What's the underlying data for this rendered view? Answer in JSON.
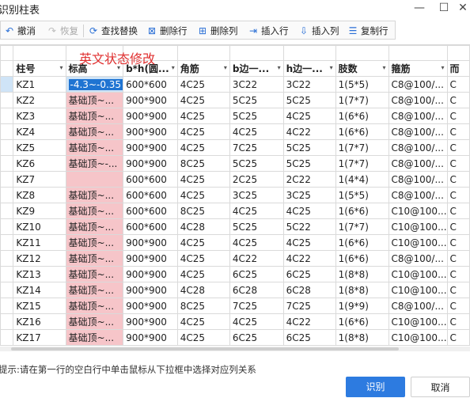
{
  "window": {
    "title": "识别柱表",
    "minimize_glyph": "—",
    "maximize_glyph": "☐",
    "close_glyph": "✕"
  },
  "toolbar": {
    "undo": {
      "label": "撤消",
      "icon": "undo-icon"
    },
    "redo": {
      "label": "恢复",
      "icon": "redo-icon"
    },
    "find_replace": {
      "label": "查找替换",
      "icon": "find-replace-icon"
    },
    "delete_row": {
      "label": "删除行",
      "icon": "delete-row-icon"
    },
    "delete_col": {
      "label": "删除列",
      "icon": "delete-column-icon"
    },
    "insert_row": {
      "label": "插入行",
      "icon": "insert-row-icon"
    },
    "insert_col": {
      "label": "插入列",
      "icon": "insert-column-icon"
    },
    "copy_row": {
      "label": "复制行",
      "icon": "copy-row-icon"
    }
  },
  "overlay_text": "英文状态修改",
  "grid": {
    "headers": [
      "柱号",
      "标高",
      "b*h(圆...",
      "角筋",
      "b边一...",
      "h边一...",
      "肢数",
      "箍筋",
      "而"
    ],
    "editing_value": "-4.3~-0.35",
    "rows": [
      [
        "KZ1",
        "-4.3~-0.35",
        "600*600",
        "4C25",
        "3C22",
        "3C22",
        "1(5*5)",
        "C8@100/..."
      ],
      [
        "KZ2",
        "基础顶~...",
        "900*900",
        "4C25",
        "5C25",
        "5C25",
        "1(7*7)",
        "C8@100/..."
      ],
      [
        "KZ3",
        "基础顶~...",
        "900*900",
        "4C25",
        "5C25",
        "4C25",
        "1(6*6)",
        "C8@100/..."
      ],
      [
        "KZ4",
        "基础顶~...",
        "900*900",
        "4C25",
        "4C25",
        "4C22",
        "1(6*6)",
        "C8@100/..."
      ],
      [
        "KZ5",
        "基础顶~...",
        "900*900",
        "4C25",
        "7C25",
        "5C25",
        "1(7*7)",
        "C8@100/..."
      ],
      [
        "KZ6",
        "基础顶~-...",
        "900*900",
        "8C25",
        "5C25",
        "5C25",
        "1(7*7)",
        "C8@100/..."
      ],
      [
        "KZ7",
        "",
        "600*600",
        "4C25",
        "2C25",
        "2C22",
        "1(4*4)",
        "C8@100/..."
      ],
      [
        "KZ8",
        "基础顶~...",
        "600*600",
        "4C25",
        "3C25",
        "3C25",
        "1(5*5)",
        "C8@100/..."
      ],
      [
        "KZ9",
        "基础顶~...",
        "600*600",
        "8C25",
        "4C25",
        "4C25",
        "1(6*6)",
        "C10@100..."
      ],
      [
        "KZ10",
        "基础顶~...",
        "600*600",
        "4C28",
        "5C25",
        "5C22",
        "1(7*7)",
        "C10@100..."
      ],
      [
        "KZ11",
        "基础顶~...",
        "900*900",
        "4C25",
        "4C25",
        "4C25",
        "1(6*6)",
        "C10@100..."
      ],
      [
        "KZ12",
        "基础顶~...",
        "900*900",
        "4C25",
        "4C22",
        "4C22",
        "1(6*6)",
        "C8@100/..."
      ],
      [
        "KZ13",
        "基础顶~...",
        "900*900",
        "4C25",
        "6C25",
        "6C25",
        "1(8*8)",
        "C10@100..."
      ],
      [
        "KZ14",
        "基础顶~...",
        "900*900",
        "4C28",
        "6C28",
        "6C28",
        "1(8*8)",
        "C10@100..."
      ],
      [
        "KZ15",
        "基础顶~...",
        "900*900",
        "8C25",
        "7C25",
        "7C25",
        "1(9*9)",
        "C8@100/..."
      ],
      [
        "KZ16",
        "基础顶~...",
        "900*900",
        "4C25",
        "4C25",
        "4C22",
        "1(6*6)",
        "C10@100..."
      ],
      [
        "KZ17",
        "基础顶~...",
        "900*900",
        "4C25",
        "6C25",
        "6C25",
        "1(8*8)",
        "C10@100..."
      ]
    ],
    "last_col_cells": [
      "C",
      "C",
      "C",
      "C",
      "C",
      "C",
      "C",
      "C",
      "C",
      "C",
      "C",
      "C",
      "C",
      "C",
      "C",
      "C",
      "C"
    ]
  },
  "hint": "提示:请在第一行的空白行中单击鼠标从下拉框中选择对应列关系",
  "buttons": {
    "confirm": "识别",
    "cancel": "取消"
  },
  "colors": {
    "accent": "#2d7be0",
    "highlight_pink": "#f6c5c9",
    "selection_blue": "#cfe4f7",
    "overlay_red": "#e03030"
  }
}
